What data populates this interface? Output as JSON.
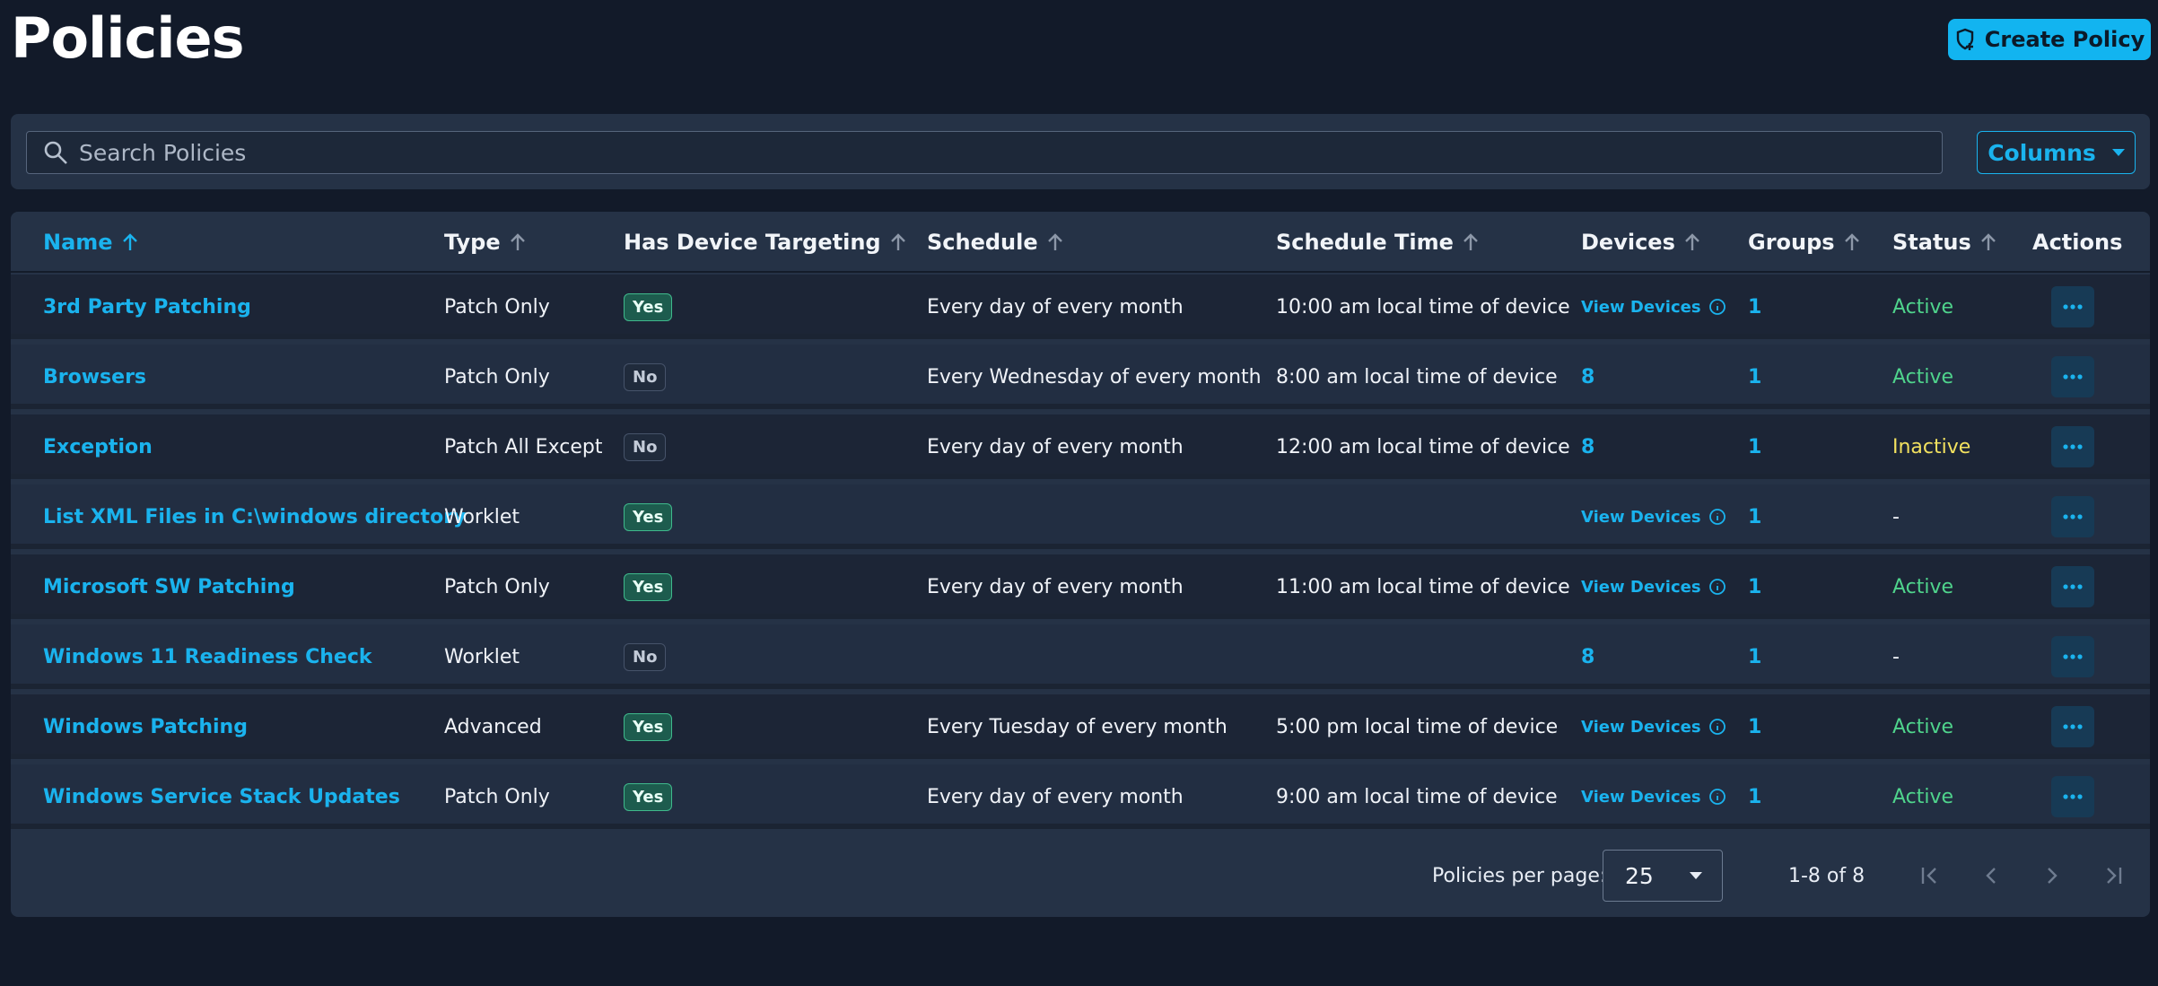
{
  "header": {
    "title": "Policies",
    "create_label": "Create Policy"
  },
  "search": {
    "placeholder": "Search Policies"
  },
  "columns_label": "Columns",
  "table": {
    "headers": [
      "Name",
      "Type",
      "Has Device Targeting",
      "Schedule",
      "Schedule Time",
      "Devices",
      "Groups",
      "Status",
      "Actions"
    ],
    "rows": [
      {
        "name": "3rd Party Patching",
        "type": "Patch Only",
        "targeting": "Yes",
        "schedule": "Every day of every month",
        "time": "10:00 am local time of device",
        "devices": "View Devices",
        "groups": "1",
        "status": "Active"
      },
      {
        "name": "Browsers",
        "type": "Patch Only",
        "targeting": "No",
        "schedule": "Every Wednesday of every month",
        "time": "8:00 am local time of device",
        "devices": "8",
        "groups": "1",
        "status": "Active"
      },
      {
        "name": "Exception",
        "type": "Patch All Except",
        "targeting": "No",
        "schedule": "Every day of every month",
        "time": "12:00 am local time of device",
        "devices": "8",
        "groups": "1",
        "status": "Inactive"
      },
      {
        "name": "List XML Files in C:\\windows directory",
        "type": "Worklet",
        "targeting": "Yes",
        "schedule": "",
        "time": "",
        "devices": "View Devices",
        "groups": "1",
        "status": "-"
      },
      {
        "name": "Microsoft SW Patching",
        "type": "Patch Only",
        "targeting": "Yes",
        "schedule": "Every day of every month",
        "time": "11:00 am local time of device",
        "devices": "View Devices",
        "groups": "1",
        "status": "Active"
      },
      {
        "name": "Windows 11 Readiness Check",
        "type": "Worklet",
        "targeting": "No",
        "schedule": "",
        "time": "",
        "devices": "8",
        "groups": "1",
        "status": "-"
      },
      {
        "name": "Windows Patching",
        "type": "Advanced",
        "targeting": "Yes",
        "schedule": "Every Tuesday of every month",
        "time": "5:00 pm local time of device",
        "devices": "View Devices",
        "groups": "1",
        "status": "Active"
      },
      {
        "name": "Windows Service Stack Updates",
        "type": "Patch Only",
        "targeting": "Yes",
        "schedule": "Every day of every month",
        "time": "9:00 am local time of device",
        "devices": "View Devices",
        "groups": "1",
        "status": "Active"
      }
    ]
  },
  "pagination": {
    "per_page_label": "Policies per page:",
    "per_page_value": "25",
    "range": "1-8 of 8"
  },
  "colors": {
    "background": "#121a29",
    "accent": "#1ab3ee",
    "active": "#4fd48c",
    "inactive": "#f2e15f"
  }
}
